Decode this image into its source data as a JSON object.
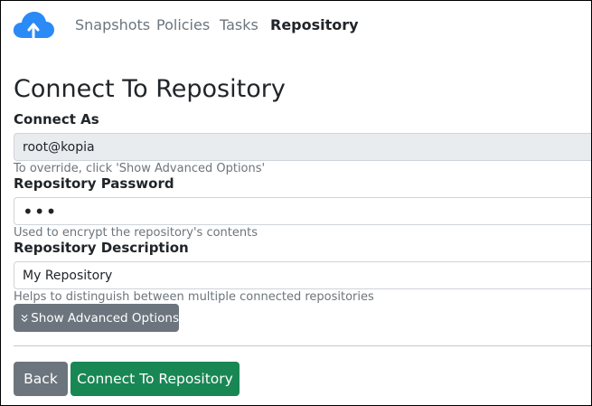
{
  "nav": {
    "logo_icon": "cloud-upload-icon",
    "brand_color": "#2a8af6",
    "items": [
      {
        "label": "Snapshots",
        "active": false
      },
      {
        "label": "Policies",
        "active": false
      },
      {
        "label": "Tasks",
        "active": false
      },
      {
        "label": "Repository",
        "active": true
      }
    ]
  },
  "page": {
    "title": "Connect To Repository"
  },
  "form": {
    "connect_as": {
      "label": "Connect As",
      "value": "root@kopia",
      "help": "To override, click 'Show Advanced Options'"
    },
    "password": {
      "label": "Repository Password",
      "value": "•••",
      "help": "Used to encrypt the repository's contents"
    },
    "description": {
      "label": "Repository Description",
      "value": "My Repository",
      "help": "Helps to distinguish between multiple connected repositories"
    },
    "advanced_button": {
      "label": "Show Advanced Options",
      "icon": "chevrons-down-icon"
    }
  },
  "actions": {
    "back_label": "Back",
    "connect_label": "Connect To Repository",
    "back_color": "#6c757d",
    "connect_color": "#198754"
  }
}
